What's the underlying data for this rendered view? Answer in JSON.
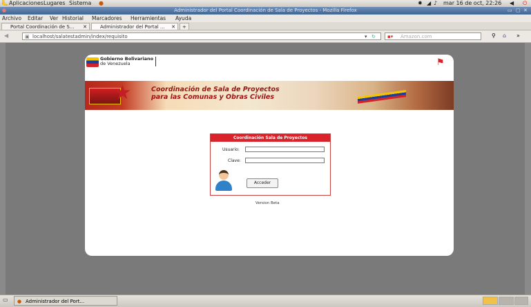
{
  "top_panel": {
    "menus": [
      "Aplicaciones",
      "Lugares",
      "Sistema"
    ],
    "clock": "mar 16 de oct, 22:26"
  },
  "window": {
    "title": "Administrador del Portal Coordinación de Sala de Proyectos - Mozilla Firefox"
  },
  "menubar": {
    "items": [
      "Archivo",
      "Editar",
      "Ver",
      "Historial",
      "Marcadores",
      "Herramientas",
      "Ayuda"
    ]
  },
  "tabs": [
    {
      "label": "Portal Coordinación de S..."
    },
    {
      "label": "Administrador del Portal ..."
    }
  ],
  "navbar": {
    "url": "localhost/salatestadmin/index/requisito",
    "search_placeholder": "Amazon.com"
  },
  "page": {
    "gov_logo_line1": "Gobierno Bolivariano",
    "gov_logo_line2": "de Venezuela",
    "banner_title_line1": "Coordinación de Sala de Proyectos",
    "banner_title_line2": "para las Comunas y Obras Civiles",
    "login": {
      "heading": "Coordinación Sala de Proyectos",
      "user_label": "Usuario:",
      "user_value": "",
      "password_label": "Clave:",
      "password_value": "",
      "submit_label": "Acceder"
    },
    "version": "Version Beta"
  },
  "taskbar": {
    "window_button": "Administrador del Port..."
  },
  "colors": {
    "accent_red": "#d9232a",
    "titlebar_blue": "#4a6f9c"
  }
}
